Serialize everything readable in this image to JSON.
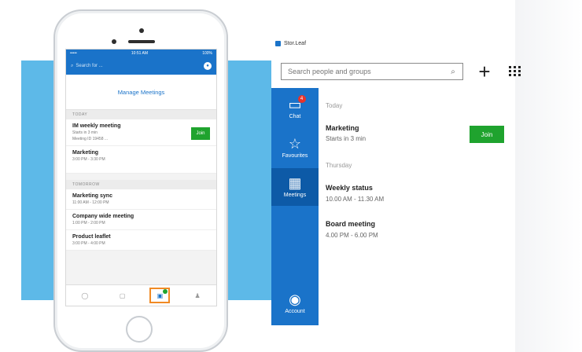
{
  "phone": {
    "status": {
      "carrier": "•••••",
      "time": "10:51 AM",
      "battery": "100%"
    },
    "search_placeholder": "Search for ...",
    "header_title": "Manage Meetings",
    "section_today": "TODAY",
    "section_tomorrow": "TOMORROW",
    "today": [
      {
        "title": "IM weekly meeting",
        "time": "Starts in 3 min",
        "detail": "Meeting ID 19458 ..."
      },
      {
        "title": "Marketing",
        "time": "3:00 PM - 3:30 PM"
      }
    ],
    "join_label": "Join",
    "tomorrow": [
      {
        "title": "Marketing sync",
        "time": "11:00 AM - 12:00 PM"
      },
      {
        "title": "Company wide meeting",
        "time": "1:00 PM - 2:00 PM"
      },
      {
        "title": "Product leaflet",
        "time": "3:00 PM - 4:00 PM"
      }
    ]
  },
  "app": {
    "title": "Stor.Leaf",
    "search_placeholder": "Search people and groups",
    "sidebar": {
      "chat_label": "Chat",
      "chat_badge": "4",
      "favourites_label": "Favourites",
      "meetings_label": "Meetings",
      "account_label": "Account"
    },
    "today_label": "Today",
    "thursday_label": "Thursday",
    "join_label": "Join",
    "meetings": [
      {
        "title": "Marketing",
        "time": "Starts in 3 min"
      },
      {
        "title": "Weekly status",
        "time": "10.00 AM - 11.30 AM"
      },
      {
        "title": "Board meeting",
        "time": "4.00 PM - 6.00 PM"
      }
    ],
    "accent_color": "#1a73c9",
    "join_color": "#1fa32e"
  }
}
